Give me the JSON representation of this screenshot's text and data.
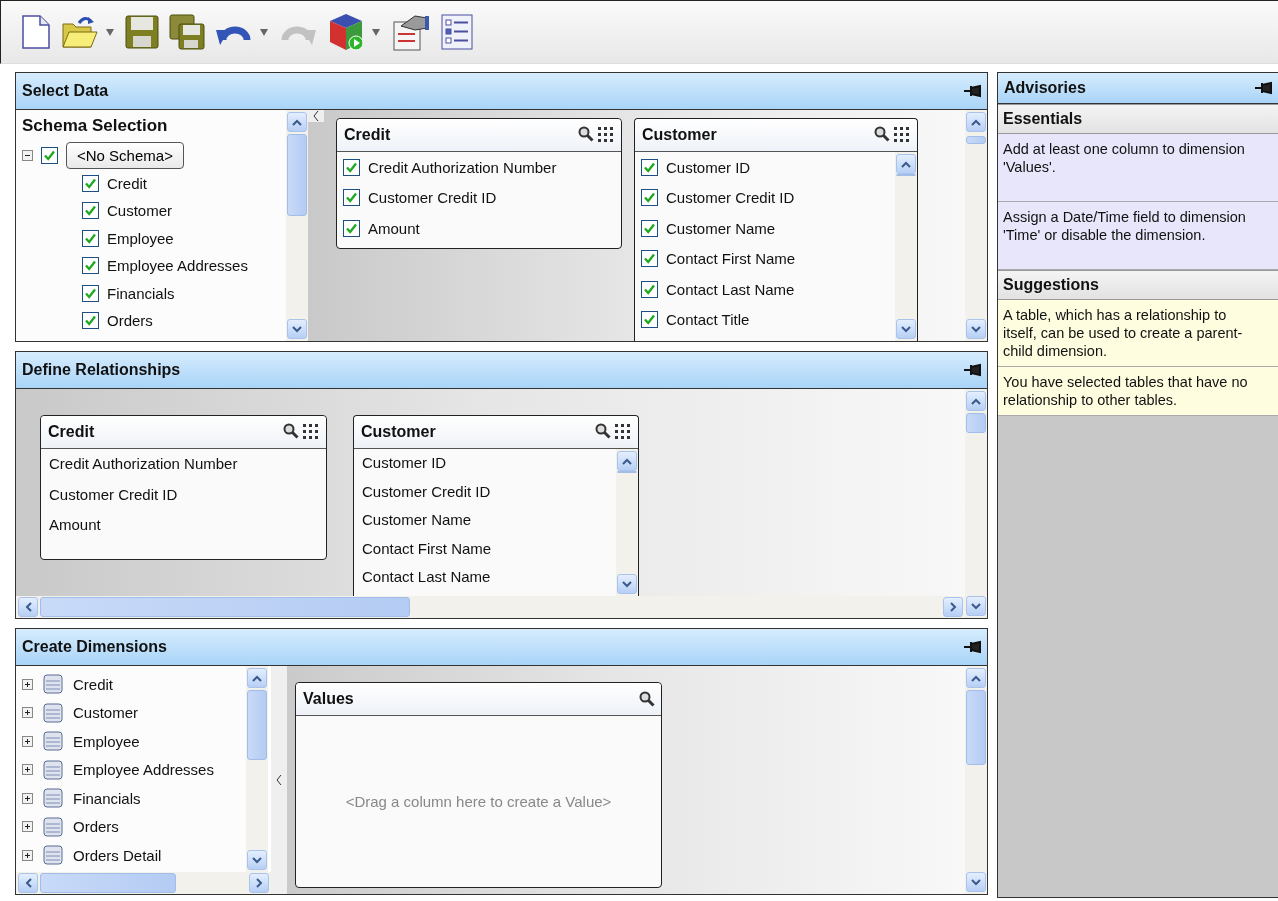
{
  "toolbar": [
    {
      "kind": "new",
      "dropdown": false,
      "disabled": false
    },
    {
      "kind": "open",
      "dropdown": true,
      "disabled": false
    },
    {
      "kind": "save",
      "dropdown": false,
      "disabled": false
    },
    {
      "kind": "save_all",
      "dropdown": false,
      "disabled": false
    },
    {
      "kind": "undo",
      "dropdown": true,
      "disabled": false
    },
    {
      "kind": "redo",
      "dropdown": false,
      "disabled": true
    },
    {
      "kind": "cube",
      "dropdown": true,
      "disabled": false
    },
    {
      "kind": "properties",
      "dropdown": false,
      "disabled": false
    },
    {
      "kind": "list",
      "dropdown": false,
      "disabled": false
    }
  ],
  "select_data": {
    "title": "Select Data",
    "schema_selection": {
      "title": "Schema Selection",
      "root": {
        "label": "<No Schema>",
        "checked": true,
        "expanded": true,
        "children": [
          {
            "label": "Credit",
            "checked": true
          },
          {
            "label": "Customer",
            "checked": true
          },
          {
            "label": "Employee",
            "checked": true
          },
          {
            "label": "Employee Addresses",
            "checked": true
          },
          {
            "label": "Financials",
            "checked": true
          },
          {
            "label": "Orders",
            "checked": true
          }
        ]
      }
    },
    "tables": [
      {
        "title": "Credit",
        "columns": [
          {
            "label": "Credit Authorization Number",
            "checked": true
          },
          {
            "label": "Customer Credit ID",
            "checked": true
          },
          {
            "label": "Amount",
            "checked": true
          }
        ]
      },
      {
        "title": "Customer",
        "columns": [
          {
            "label": "Customer ID",
            "checked": true
          },
          {
            "label": "Customer Credit ID",
            "checked": true
          },
          {
            "label": "Customer Name",
            "checked": true
          },
          {
            "label": "Contact First Name",
            "checked": true
          },
          {
            "label": "Contact Last Name",
            "checked": true
          },
          {
            "label": "Contact Title",
            "checked": true
          }
        ]
      }
    ]
  },
  "define_relationships": {
    "title": "Define Relationships",
    "tables": [
      {
        "title": "Credit",
        "columns": [
          "Credit Authorization Number",
          "Customer Credit ID",
          "Amount"
        ]
      },
      {
        "title": "Customer",
        "columns": [
          "Customer ID",
          "Customer Credit ID",
          "Customer Name",
          "Contact First Name",
          "Contact Last Name"
        ]
      }
    ]
  },
  "create_dimensions": {
    "title": "Create Dimensions",
    "tree": [
      {
        "label": "Credit",
        "expanded": false
      },
      {
        "label": "Customer",
        "expanded": false
      },
      {
        "label": "Employee",
        "expanded": false
      },
      {
        "label": "Employee Addresses",
        "expanded": false
      },
      {
        "label": "Financials",
        "expanded": false
      },
      {
        "label": "Orders",
        "expanded": false
      },
      {
        "label": "Orders Detail",
        "expanded": false
      }
    ],
    "values_box": {
      "title": "Values",
      "placeholder": "<Drag a column here to create a Value>"
    }
  },
  "advisories": {
    "title": "Advisories",
    "sections": [
      {
        "kind": "essentials",
        "title": "Essentials",
        "items": [
          "Add at least one column to dimension 'Values'.",
          "Assign a Date/Time field to dimension 'Time' or disable the dimension."
        ]
      },
      {
        "kind": "suggestions",
        "title": "Suggestions",
        "items": [
          "A table, which has a relationship to itself, can be used to create a parent-child dimension.",
          "You have selected tables that have no relationship to other tables."
        ]
      }
    ]
  }
}
